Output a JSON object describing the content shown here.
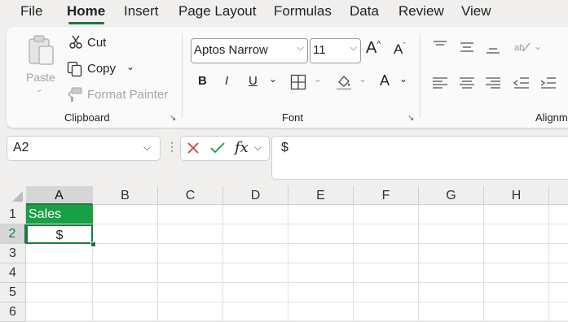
{
  "menu": {
    "tabs": [
      "File",
      "Home",
      "Insert",
      "Page Layout",
      "Formulas",
      "Data",
      "Review",
      "View"
    ],
    "active": "Home"
  },
  "ribbon": {
    "clipboard": {
      "paste_label": "Paste",
      "cut_label": "Cut",
      "copy_label": "Copy",
      "format_painter_label": "Format Painter",
      "group_label": "Clipboard"
    },
    "font": {
      "font_name": "Aptos Narrow",
      "font_size": "11",
      "bold": "B",
      "italic": "I",
      "underline": "U",
      "font_color_glyph": "A",
      "group_label": "Font"
    },
    "alignment": {
      "group_label": "Alignm"
    }
  },
  "formula_bar": {
    "name_box": "A2",
    "fx_label": "fx",
    "content": "$"
  },
  "sheet": {
    "columns": [
      "A",
      "B",
      "C",
      "D",
      "E",
      "F",
      "G",
      "H"
    ],
    "rows": [
      "1",
      "2",
      "3",
      "4",
      "5",
      "6"
    ],
    "cells": {
      "A1": "Sales",
      "A2": "$"
    },
    "selected_cell": "A2",
    "header_fill": "#17a046",
    "accent": "#1a7a42"
  }
}
